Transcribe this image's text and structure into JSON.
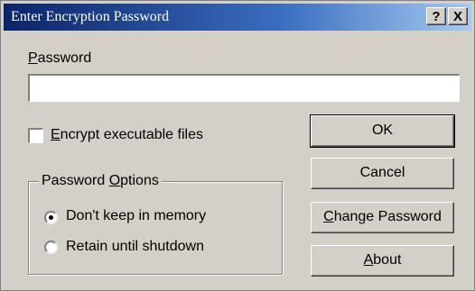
{
  "window": {
    "title": "Enter Encryption Password",
    "help_button": "?",
    "close_button": "X"
  },
  "password": {
    "label_mnemonic": "P",
    "label_rest": "assword",
    "value": ""
  },
  "encrypt_executable": {
    "label_mnemonic": "E",
    "label_rest": "ncrypt executable files",
    "checked": false
  },
  "password_options": {
    "title_before": "Password ",
    "title_mnemonic": "O",
    "title_after": "ptions",
    "options": [
      {
        "label": "Don't keep in memory",
        "selected": true
      },
      {
        "label": "Retain until shutdown",
        "selected": false
      }
    ]
  },
  "buttons": {
    "ok": "OK",
    "cancel": "Cancel",
    "change_password_mnemonic": "C",
    "change_password_rest": "hange Password",
    "about_mnemonic": "A",
    "about_rest": "bout"
  }
}
